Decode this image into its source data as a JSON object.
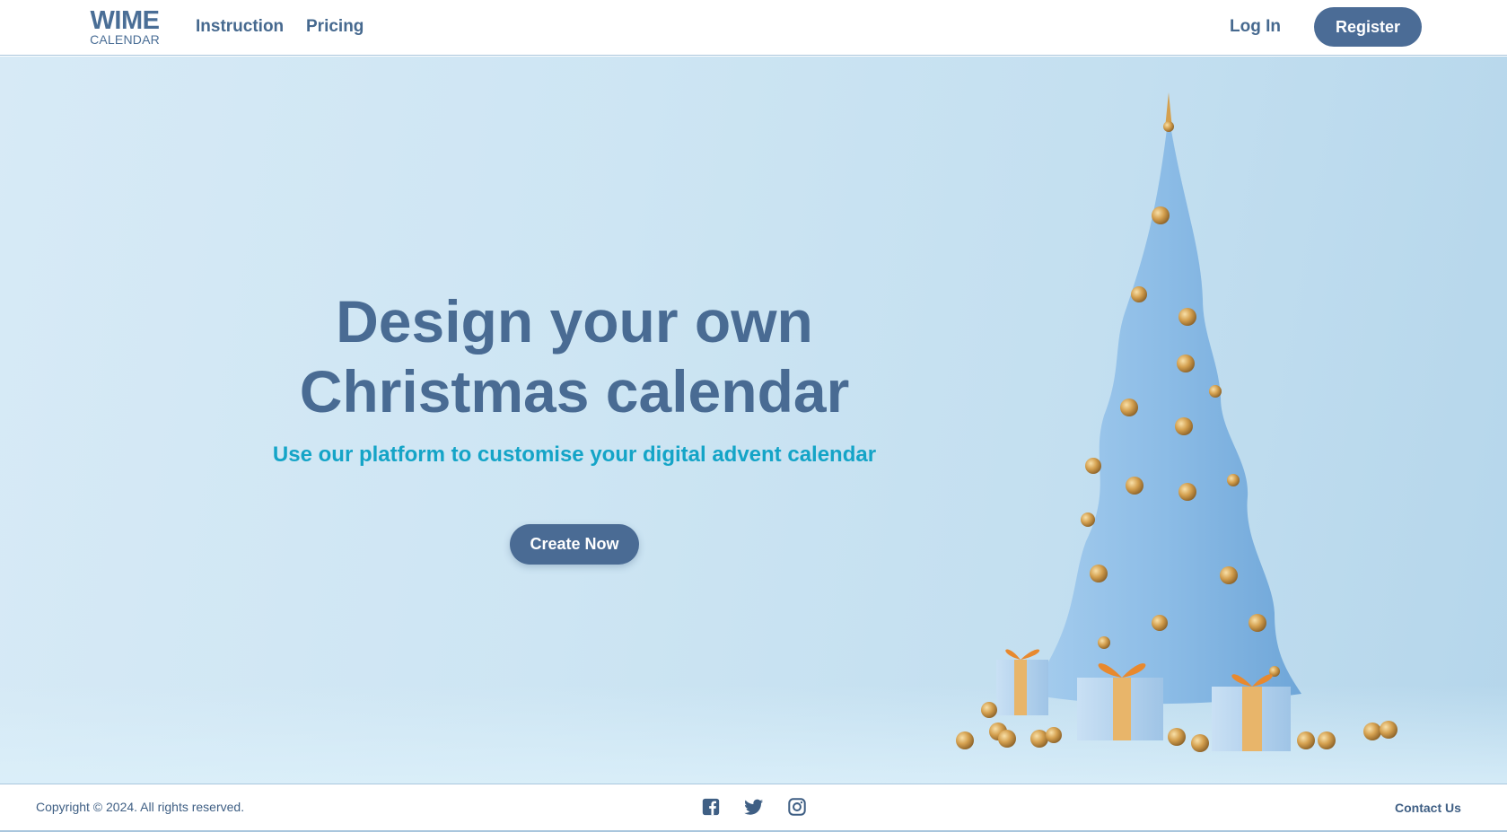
{
  "header": {
    "logo_main": "WIME",
    "logo_sub": "CALENDAR",
    "nav": [
      "Instruction",
      "Pricing"
    ],
    "login_label": "Log In",
    "register_label": "Register"
  },
  "hero": {
    "title_line1": "Design your own",
    "title_line2": "Christmas calendar",
    "subtitle": "Use our platform to customise your digital advent calendar",
    "cta_label": "Create Now"
  },
  "footer": {
    "copyright": "Copyright © 2024. All rights reserved.",
    "social_icons": [
      "facebook-icon",
      "twitter-icon",
      "instagram-icon"
    ],
    "contact_label": "Contact Us"
  },
  "colors": {
    "brand": "#4a6b94",
    "accent": "#14a4c7",
    "hero_bg": "#cde5f3",
    "tree": "#8cbce6",
    "ornament": "#d4a04f"
  }
}
